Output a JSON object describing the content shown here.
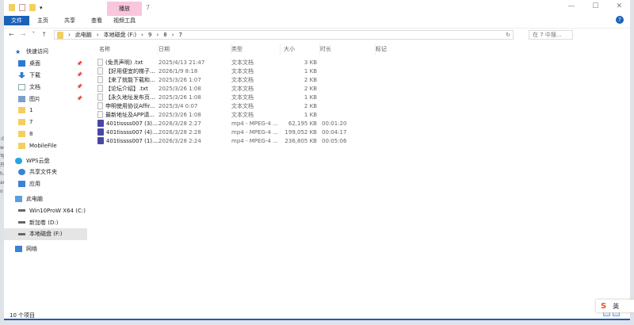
{
  "window": {
    "title": "7",
    "context_tab": "播放",
    "controls": [
      "—",
      "☐",
      "✕"
    ]
  },
  "ribbon": {
    "tabs": [
      "文件",
      "主页",
      "共享",
      "查看"
    ],
    "context_tab": "视频工具",
    "help": "?"
  },
  "address": {
    "crumbs": [
      "此电脑",
      "本地磁盘 (F:)",
      "9",
      "8",
      "7"
    ],
    "search_placeholder": "在 7 中搜..."
  },
  "sidebar": {
    "items": [
      {
        "label": "快速访问",
        "icon": "star-icon",
        "level": 0
      },
      {
        "label": "桌面",
        "icon": "desktop-icon",
        "pinned": true
      },
      {
        "label": "下载",
        "icon": "download-icon",
        "pinned": true
      },
      {
        "label": "文档",
        "icon": "document-icon",
        "pinned": true
      },
      {
        "label": "图片",
        "icon": "picture-icon",
        "pinned": true
      },
      {
        "label": "1",
        "icon": "folder-icon"
      },
      {
        "label": "7",
        "icon": "folder-icon"
      },
      {
        "label": "8",
        "icon": "folder-icon"
      },
      {
        "label": "MobileFile",
        "icon": "folder-icon"
      },
      {
        "label": "WPS云盘",
        "icon": "cloud-icon",
        "level": 0
      },
      {
        "label": "共享文件夹",
        "icon": "share-icon"
      },
      {
        "label": "应用",
        "icon": "apps-icon"
      },
      {
        "label": "此电脑",
        "icon": "computer-icon",
        "level": 0
      },
      {
        "label": "Win10ProW X64 (C:)",
        "icon": "drive-icon"
      },
      {
        "label": "新加卷 (D:)",
        "icon": "drive-icon"
      },
      {
        "label": "本地磁盘 (F:)",
        "icon": "drive-icon",
        "selected": true
      },
      {
        "label": "网络",
        "icon": "network-icon",
        "level": 0
      }
    ]
  },
  "columns": [
    "名称",
    "日期",
    "类型",
    "大小",
    "时长",
    "标记"
  ],
  "files": [
    {
      "name": "(免责声明) .txt",
      "date": "2025/4/13 21:47",
      "type": "文本文档",
      "size": "3 KB",
      "duration": "",
      "kind": "txt"
    },
    {
      "name": "【好用便宜的梯子...",
      "date": "2026/1/9 8:18",
      "type": "文本文档",
      "size": "1 KB",
      "duration": "",
      "kind": "txt"
    },
    {
      "name": "【来了就能下载和...",
      "date": "2025/3/26 1:07",
      "type": "文本文档",
      "size": "2 KB",
      "duration": "",
      "kind": "txt"
    },
    {
      "name": "【论坛介绍】.txt",
      "date": "2025/3/26 1:08",
      "type": "文本文档",
      "size": "2 KB",
      "duration": "",
      "kind": "txt"
    },
    {
      "name": "【永久地址发布页...",
      "date": "2025/3/26 1:08",
      "type": "文本文档",
      "size": "1 KB",
      "duration": "",
      "kind": "txt"
    },
    {
      "name": "申明使用协议Affir...",
      "date": "2025/3/4 0:07",
      "type": "文本文档",
      "size": "2 KB",
      "duration": "",
      "kind": "txt"
    },
    {
      "name": "最新地址及APP请...",
      "date": "2025/3/26 1:08",
      "type": "文本文档",
      "size": "1 KB",
      "duration": "",
      "kind": "txt"
    },
    {
      "name": "401tissss007 (3)....",
      "date": "2026/3/28 2:27",
      "type": "mp4 - MPEG-4 ...",
      "size": "62,195 KB",
      "duration": "00:01:20",
      "kind": "mp4"
    },
    {
      "name": "401tissss007 (4)....",
      "date": "2026/3/28 2:28",
      "type": "mp4 - MPEG-4 ...",
      "size": "199,052 KB",
      "duration": "00:04:17",
      "kind": "mp4"
    },
    {
      "name": "401tissss007 (1)....",
      "date": "2026/3/28 2:24",
      "type": "mp4 - MPEG-4 ...",
      "size": "236,805 KB",
      "duration": "00:05:06",
      "kind": "mp4"
    }
  ],
  "status": {
    "count": "10 个项目"
  },
  "ime": {
    "logo": "S",
    "mode": "英"
  }
}
